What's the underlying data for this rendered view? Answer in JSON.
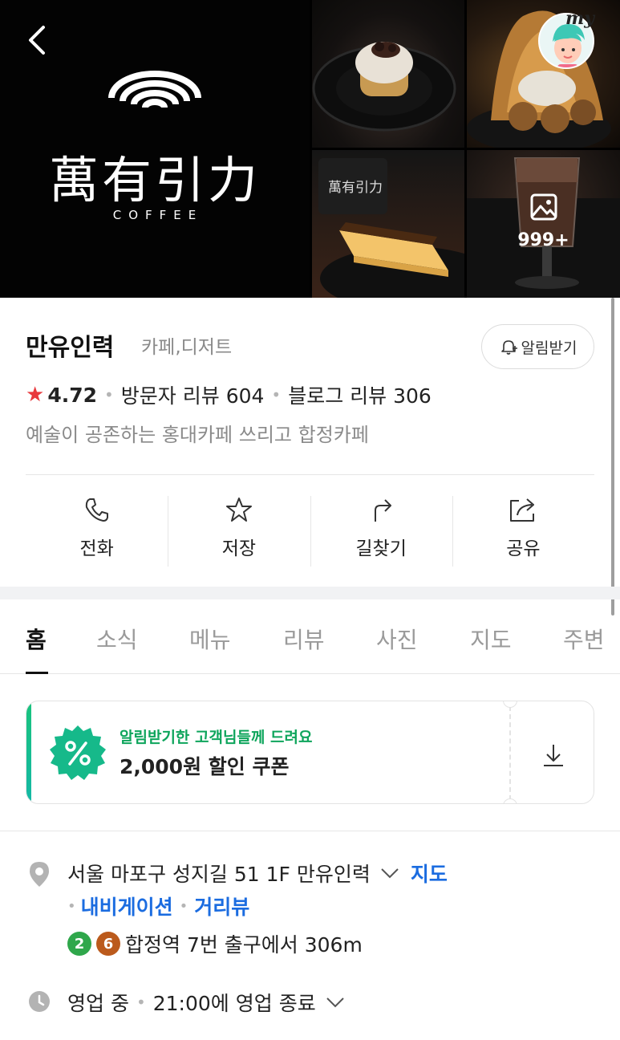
{
  "gallery": {
    "logo_cjk": "萬有引力",
    "logo_coffee": "COFFEE",
    "photo_count": "999+",
    "my_label": "my"
  },
  "place": {
    "name": "만유인력",
    "category": "카페,디저트",
    "alarm_button": "알림받기",
    "rating": "4.72",
    "visitor_reviews": "방문자 리뷰 604",
    "blog_reviews": "블로그 리뷰 306",
    "tagline": "예술이 공존하는 홍대카페 쓰리고 합정카페"
  },
  "actions": [
    {
      "label": "전화",
      "icon": "phone-icon"
    },
    {
      "label": "저장",
      "icon": "star-outline-icon"
    },
    {
      "label": "길찾기",
      "icon": "directions-icon"
    },
    {
      "label": "공유",
      "icon": "share-icon"
    }
  ],
  "tabs": [
    "홈",
    "소식",
    "메뉴",
    "리뷰",
    "사진",
    "지도",
    "주변"
  ],
  "active_tab": "홈",
  "coupon": {
    "subtitle": "알림받기한 고객님들께 드려요",
    "title": "2,000원 할인 쿠폰"
  },
  "info": {
    "address": "서울 마포구 성지길 51 1F 만유인력",
    "map_link": "지도",
    "navigation": "내비게이션",
    "street_view": "거리뷰",
    "subway_lines": [
      "2",
      "6"
    ],
    "subway_text": "합정역 7번 출구에서 306m",
    "status": "영업 중",
    "hours_text": "21:00에 영업 종료"
  },
  "colors": {
    "accent_blue": "#1b6ce0",
    "coupon_green": "#0ea55c",
    "star_red": "#e8383d",
    "line2": "#2fa74b",
    "line6": "#bb5a1c"
  }
}
